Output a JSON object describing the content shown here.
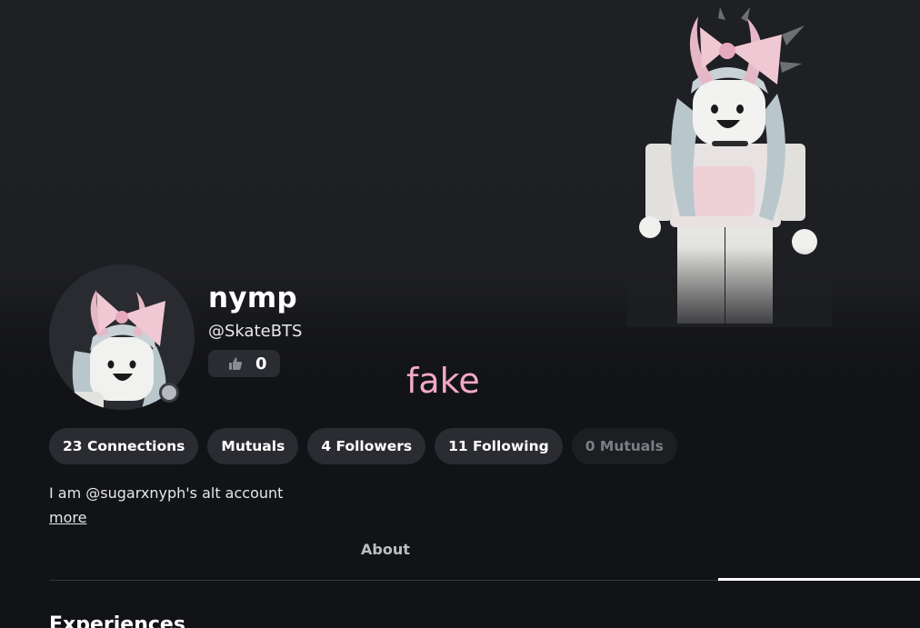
{
  "profile": {
    "display_name": "nymp",
    "username": "@SkateBTS",
    "likes": "0",
    "overlay_text": "fake",
    "bio": "I am @sugarxnyph's alt account",
    "more_label": "more"
  },
  "chips": [
    {
      "label": "23 Connections"
    },
    {
      "label": "Mutuals"
    },
    {
      "label": "4 Followers"
    },
    {
      "label": "11 Following"
    },
    {
      "label": "0 Mutuals"
    }
  ],
  "tabs": {
    "about_label": "About"
  },
  "sections": {
    "experiences_heading": "Experiences"
  },
  "icons": {
    "like": "thumbs-up-icon",
    "presence": "presence-status-icon"
  },
  "colors": {
    "background": "#121316",
    "chip_bg": "#2b2c31",
    "overlay_pink": "#f2a9c4",
    "avatar_accent_pink": "#e8b4c6"
  }
}
